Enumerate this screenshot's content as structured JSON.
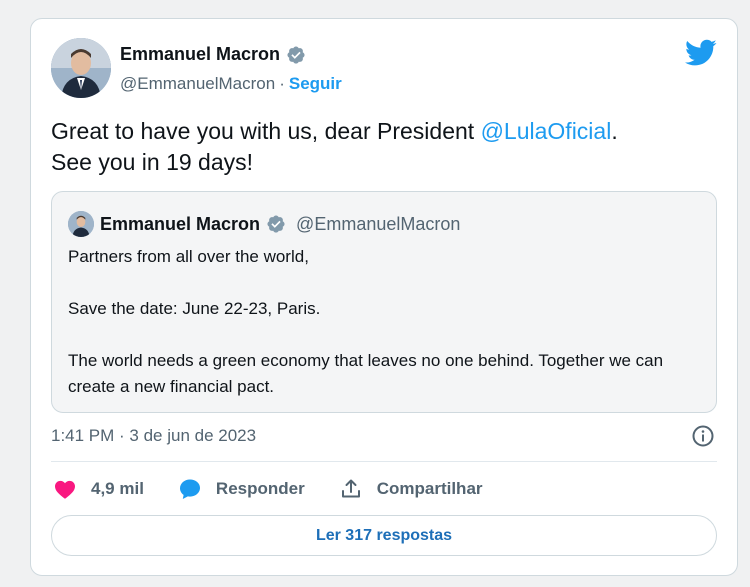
{
  "colors": {
    "accent": "#1d9bf0",
    "like": "#f91880",
    "secondary_text": "#536471",
    "primary_text": "#0f1419"
  },
  "author": {
    "name": "Emmanuel Macron",
    "handle": "@EmmanuelMacron",
    "separator": "·",
    "follow_label": "Seguir",
    "verified_icon": "verified-badge-icon"
  },
  "tweet": {
    "text_before": "Great to have you with us, dear President ",
    "mention": "@LulaOficial",
    "text_after": ".",
    "text_line2": "See you in 19 days!"
  },
  "quoted": {
    "name": "Emmanuel Macron",
    "handle": "@EmmanuelMacron",
    "paragraphs": [
      "Partners from all over the world,",
      "Save the date: June 22-23, Paris.",
      "The world needs a green economy that leaves no one behind. Together we can create a new financial pact."
    ]
  },
  "meta": {
    "timestamp": "1:41 PM · 3 de jun de 2023",
    "info_icon": "info-icon"
  },
  "actions": {
    "likes": "4,9 mil",
    "reply_label": "Responder",
    "share_label": "Compartilhar"
  },
  "replies_button": "Ler 317 respostas",
  "icons": {
    "logo": "twitter-logo-icon",
    "like": "heart-icon",
    "reply": "reply-bubble-icon",
    "share": "share-icon"
  }
}
